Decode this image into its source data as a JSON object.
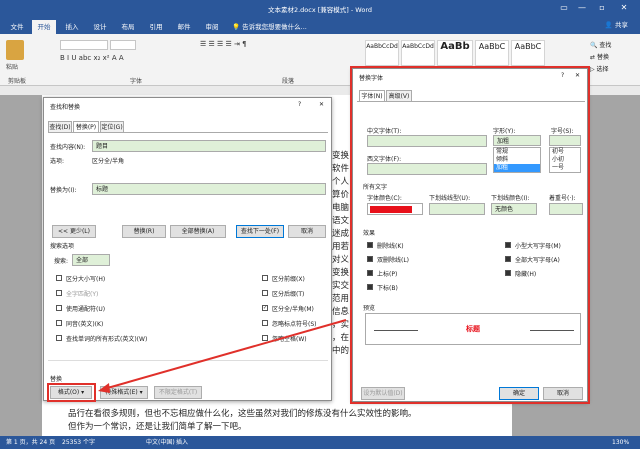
{
  "titlebar": {
    "title": "文本素材2.docx [兼容模式] - Word",
    "min": "—",
    "restore": "▫",
    "close": "✕",
    "ribbon_opts": "▭"
  },
  "tabs": [
    "文件",
    "开始",
    "插入",
    "设计",
    "布局",
    "引用",
    "邮件",
    "审阅",
    "视图"
  ],
  "search_hint": "告诉我您想要做什么...",
  "share": "共享",
  "ribbon": {
    "paste": "粘贴",
    "groups": {
      "clipboard": "剪贴板",
      "font": "字体",
      "paragraph": "段落"
    },
    "styles": [
      "AaBbCcDd",
      "AaBbCcDd",
      "AaBb",
      "AaBbC",
      "AaBbC"
    ],
    "editing": [
      "查找",
      "替换",
      "选择"
    ]
  },
  "doc": {
    "lines": [
      "变换",
      "软件",
      "个人",
      "算价",
      "电脑",
      "语文",
      "迷成",
      "用若",
      "对义",
      "变换",
      "实交",
      "范用",
      "信息",
      "，实",
      "，在",
      "中的"
    ],
    "bottom1": "品行在看很多规则，但也不忘相应做什么化，这些虽然对我们的修炼没有什么实效性的影响。",
    "bottom2": "但作为一个常识，还是让我们简单了解一下吧。"
  },
  "status": {
    "page": "第 1 页，共 24 页",
    "words": "25353 个字",
    "lang": "中文(中国)",
    "mode": "插入",
    "zoom": "130%"
  },
  "find_dialog": {
    "title": "查找和替换",
    "help": "?",
    "close": "✕",
    "tabs": [
      "查找(D)",
      "替换(P)",
      "定位(G)"
    ],
    "find_label": "查找内容(N):",
    "find_value": "题目",
    "options_label": "选项:",
    "options_value": "区分全/半角",
    "replace_label": "替换为(I):",
    "replace_value": "标题",
    "less_btn": "<< 更少(L)",
    "replace_btn": "替换(R)",
    "replace_all_btn": "全部替换(A)",
    "find_next_btn": "查找下一处(F)",
    "cancel_btn": "取消",
    "search_opts_title": "搜索选项",
    "search_label": "搜索:",
    "search_value": "全部",
    "left_opts": [
      "区分大小写(H)",
      "全字匹配(Y)",
      "使用通配符(U)",
      "同音(英文)(K)",
      "查找单词的所有形式(英文)(W)"
    ],
    "right_opts": [
      "区分前缀(X)",
      "区分后缀(T)",
      "区分全/半角(M)",
      "忽略标点符号(S)",
      "忽略空格(W)"
    ],
    "replace_section": "替换",
    "format_btn": "格式(O) ▾",
    "special_btn": "特殊格式(E) ▾",
    "no_format_btn": "不限定格式(T)"
  },
  "font_dialog": {
    "title": "替换字体",
    "help": "?",
    "close": "✕",
    "tabs": [
      "字体(N)",
      "高级(V)"
    ],
    "cn_font_label": "中文字体(T):",
    "style_label": "字形(Y):",
    "size_label": "字号(S):",
    "style_value": "加粗",
    "style_list": [
      "常规",
      "倾斜",
      "加粗"
    ],
    "size_list": [
      "初号",
      "小初",
      "一号"
    ],
    "west_font_label": "西文字体(F):",
    "all_text": "所有文字",
    "color_label": "字体颜色(C):",
    "underline_label": "下划线线型(U):",
    "underline_color_label": "下划线颜色(I):",
    "underline_color_value": "无颜色",
    "emphasis_label": "着重号(·):",
    "effects": "效果",
    "effects_left": [
      "删除线(K)",
      "双删除线(L)",
      "上标(P)",
      "下标(B)"
    ],
    "effects_right": [
      "小型大写字母(M)",
      "全部大写字母(A)",
      "隐藏(H)"
    ],
    "preview": "预览",
    "preview_text": "标题",
    "default_btn": "设为默认值(D)",
    "ok_btn": "确定",
    "cancel_btn": "取消"
  },
  "colors": {
    "accent": "#2b579a",
    "red": "#e0302a",
    "highlight": "#dff0d8",
    "font_color": "#e8101a"
  }
}
